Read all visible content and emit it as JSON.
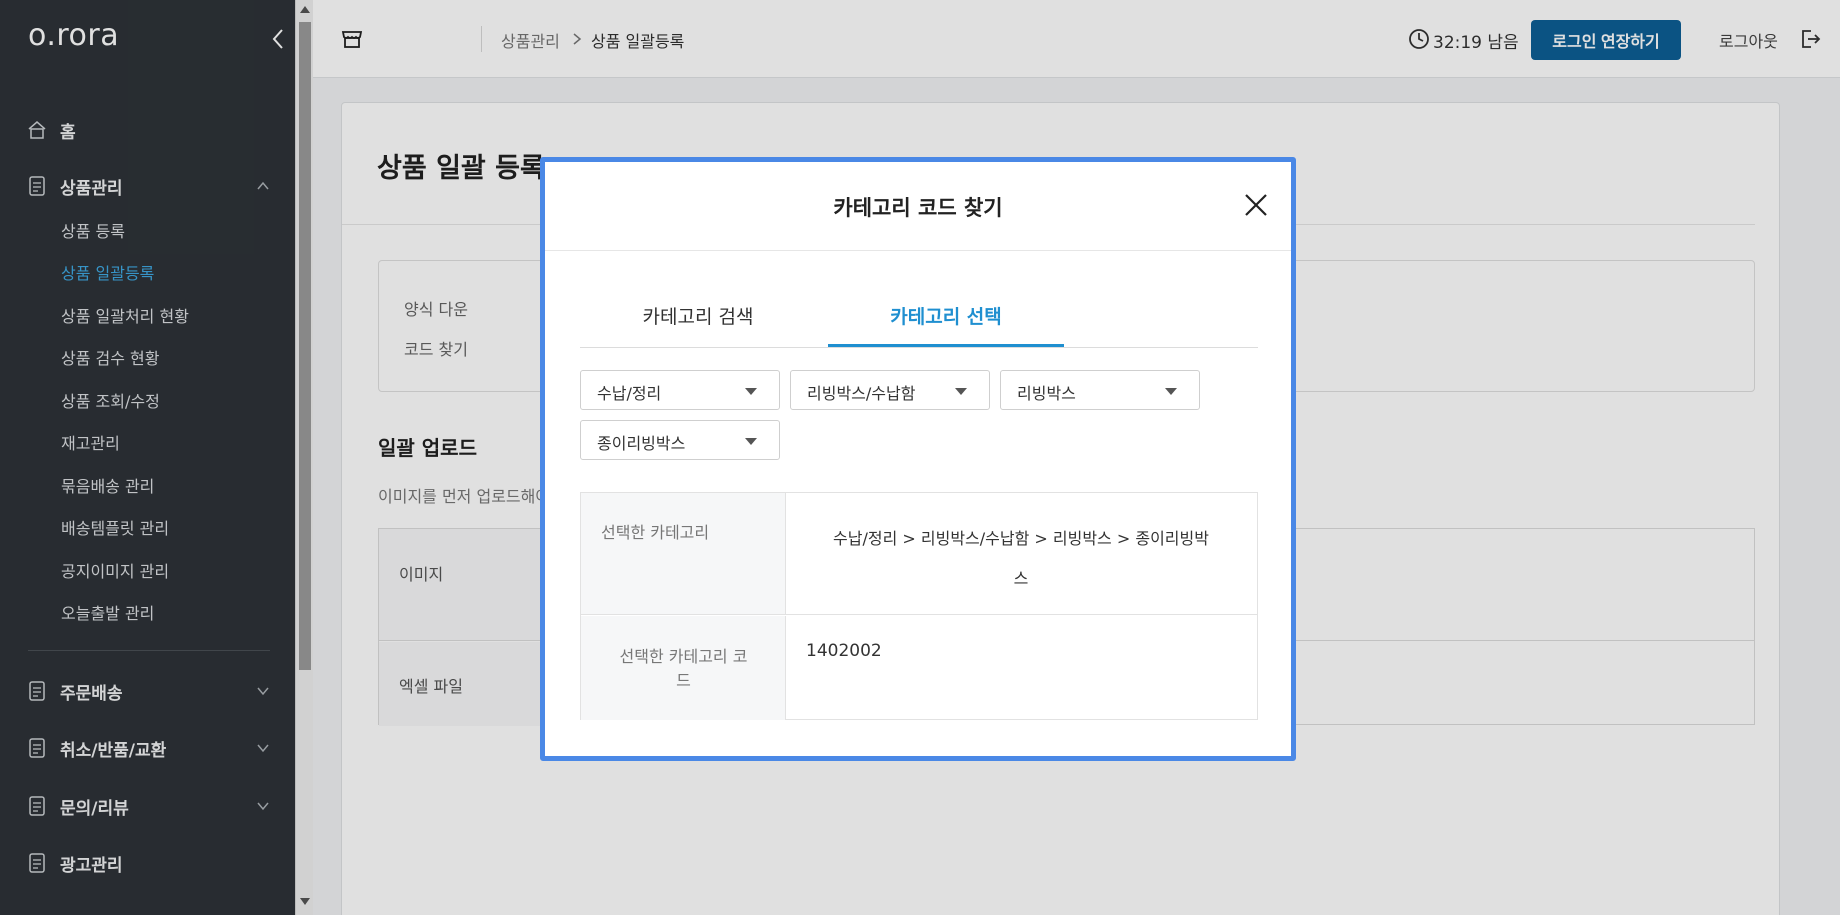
{
  "sidebar": {
    "logo": "o.rora",
    "home": "홈",
    "product_mgmt": "상품관리",
    "sub_items": [
      {
        "label": "상품 등록",
        "active": false
      },
      {
        "label": "상품 일괄등록",
        "active": true
      },
      {
        "label": "상품 일괄처리 현황",
        "active": false
      },
      {
        "label": "상품 검수 현황",
        "active": false
      },
      {
        "label": "상품 조회/수정",
        "active": false
      },
      {
        "label": "재고관리",
        "active": false
      },
      {
        "label": "묶음배송 관리",
        "active": false
      },
      {
        "label": "배송템플릿 관리",
        "active": false
      },
      {
        "label": "공지이미지 관리",
        "active": false
      },
      {
        "label": "오늘출발 관리",
        "active": false
      }
    ],
    "order_shipping": "주문배송",
    "cancel_return": "취소/반품/교환",
    "inquiry_review": "문의/리뷰",
    "ad_mgmt": "광고관리"
  },
  "header": {
    "breadcrumb_parent": "상품관리",
    "breadcrumb_current": "상품 일괄등록",
    "timer": "32:19 남음",
    "extend_button": "로그인 연장하기",
    "logout": "로그아웃"
  },
  "page": {
    "title": "상품 일괄 등록",
    "info_lines": [
      "양식 다운",
      "코드 찾기"
    ],
    "upload_title": "일괄 업로드",
    "upload_desc": "이미지를 먼저 업로드해야",
    "upload_rows": [
      "이미지",
      "엑셀 파일"
    ]
  },
  "modal": {
    "title": "카테고리 코드 찾기",
    "tabs": [
      "카테고리 검색",
      "카테고리 선택"
    ],
    "active_tab": "카테고리 선택",
    "selects": [
      "수납/정리",
      "리빙박스/수납함",
      "리빙박스",
      "종이리빙박스"
    ],
    "selected_category_label": "선택한 카테고리",
    "selected_category_path_line1": "수납/정리 > 리빙박스/수납함 > 리빙박스 > 종이리빙박",
    "selected_category_path_line2": "스",
    "selected_code_label_line1": "선택한 카테고리 코",
    "selected_code_label_line2": "드",
    "selected_code": "1402002"
  },
  "colors": {
    "sidebar_bg": "#2e3338",
    "accent": "#3fa9e3",
    "primary_button": "#0d5f96",
    "modal_border": "#4a88e6",
    "tab_active": "#1f8fd0"
  }
}
